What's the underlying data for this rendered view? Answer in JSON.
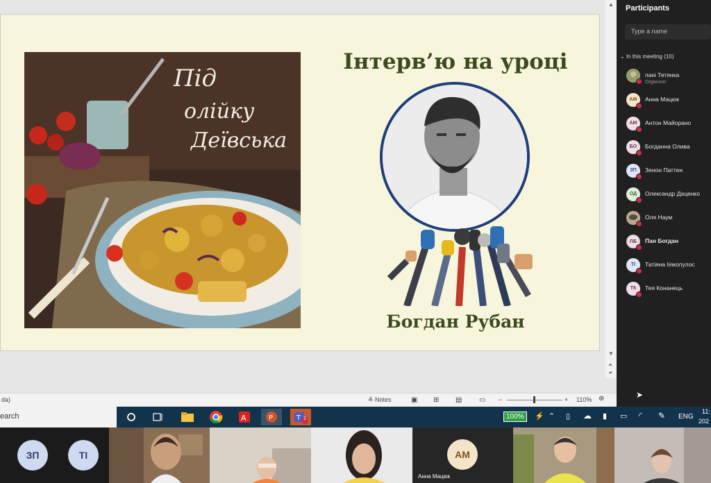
{
  "slide": {
    "title": "Інтерв’ю на уроці",
    "name": "Богдан Рубан",
    "food_title_line1": "Під",
    "food_title_line2": "олійку",
    "food_title_line3": "Деївська"
  },
  "statusbar": {
    "left_text": "da)",
    "notes_label": "Notes",
    "zoom_value": "110%"
  },
  "participants": {
    "title": "Participants",
    "search_placeholder": "Type a name",
    "section_label": "In this meeting (10)",
    "list": [
      {
        "initials": "",
        "name": "пані Тетянка",
        "role": "Organiser"
      },
      {
        "initials": "АМ",
        "name": "Анна Мацюк",
        "role": ""
      },
      {
        "initials": "АМ",
        "name": "Антон Майорано",
        "role": ""
      },
      {
        "initials": "БО",
        "name": "Богданна Олива",
        "role": ""
      },
      {
        "initials": "ЗП",
        "name": "Зенон Паттен",
        "role": ""
      },
      {
        "initials": "ОД",
        "name": "Олександр Даценко",
        "role": ""
      },
      {
        "initials": "",
        "name": "Оля Наум",
        "role": ""
      },
      {
        "initials": "ПБ",
        "name": "Пан Богдан",
        "role": ""
      },
      {
        "initials": "ТІ",
        "name": "Татіяна Ііякопулос",
        "role": ""
      },
      {
        "initials": "ТК",
        "name": "Тея Конанець",
        "role": ""
      }
    ]
  },
  "taskbar": {
    "search_text": "earch",
    "battery_label": "100%",
    "language": "ENG",
    "clock_line1": "11:",
    "clock_line2": "202",
    "teams_badge": "1"
  },
  "video": {
    "tile1_a": "ЗП",
    "tile1_b": "ТІ",
    "tile5_initials": "АМ",
    "tile5_name": "Анна Мацюк"
  },
  "colors": {
    "slide_bg": "#f7f6dc",
    "title_green": "#3d4a1f",
    "circle_blue": "#1f3e7a",
    "taskbar": "#13334a",
    "teams_panel": "#202020",
    "presence_red": "#c4314b"
  }
}
